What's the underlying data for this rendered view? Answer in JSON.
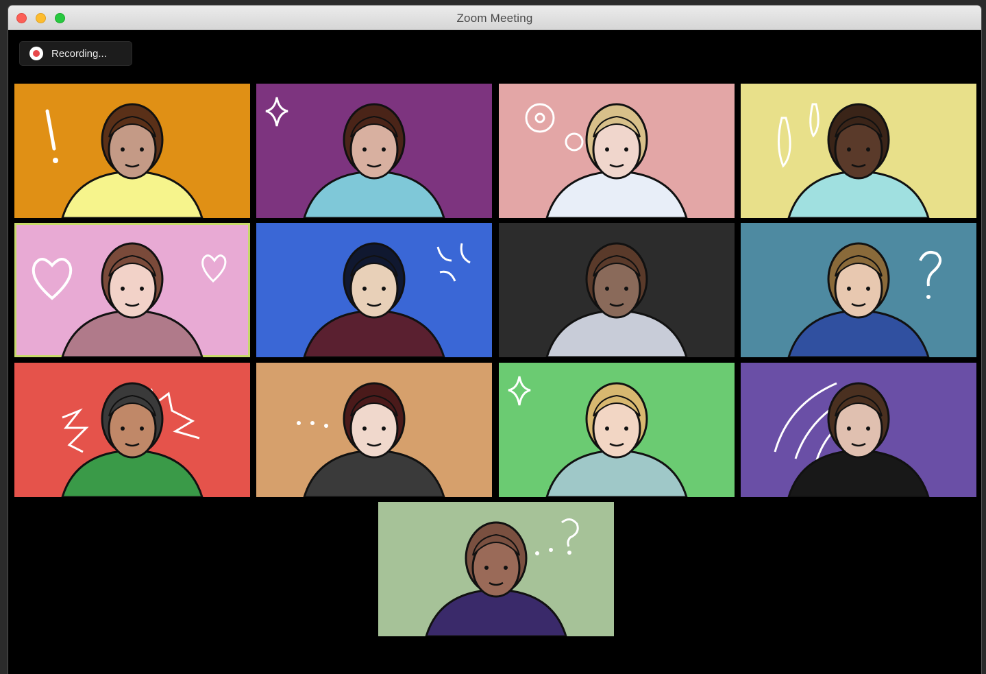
{
  "window": {
    "title": "Zoom Meeting"
  },
  "recording": {
    "label": "Recording...",
    "icon": "record-icon"
  },
  "gallery": {
    "tiles": [
      {
        "id": "p1",
        "bg": "#e09015",
        "scribble": "exclamation"
      },
      {
        "id": "p2",
        "bg": "#7d347f",
        "scribble": "sparkles"
      },
      {
        "id": "p3",
        "bg": "#e3a6a6",
        "scribble": "flowers"
      },
      {
        "id": "p4",
        "bg": "#e8e08a",
        "scribble": "sweat-drops"
      },
      {
        "id": "p5",
        "bg": "#e8aad4",
        "scribble": "hearts",
        "active": true
      },
      {
        "id": "p6",
        "bg": "#3a67d6",
        "scribble": "anger-mark"
      },
      {
        "id": "p7",
        "bg": "#2c2c2c",
        "scribble": "none"
      },
      {
        "id": "p8",
        "bg": "#4e8aa1",
        "scribble": "question-mark"
      },
      {
        "id": "p9",
        "bg": "#e5534b",
        "scribble": "zigzags"
      },
      {
        "id": "p10",
        "bg": "#d6a06c",
        "scribble": "ellipsis"
      },
      {
        "id": "p11",
        "bg": "#6bcb72",
        "scribble": "sparkles"
      },
      {
        "id": "p12",
        "bg": "#6a4fa6",
        "scribble": "motion-lines"
      },
      {
        "id": "p13",
        "bg": "#a6c298",
        "scribble": "ellipsis-question"
      }
    ]
  },
  "colors": {
    "accent_active_border": "#c7d96a",
    "recording_dot": "#e8484b",
    "window_bg": "#000000"
  }
}
